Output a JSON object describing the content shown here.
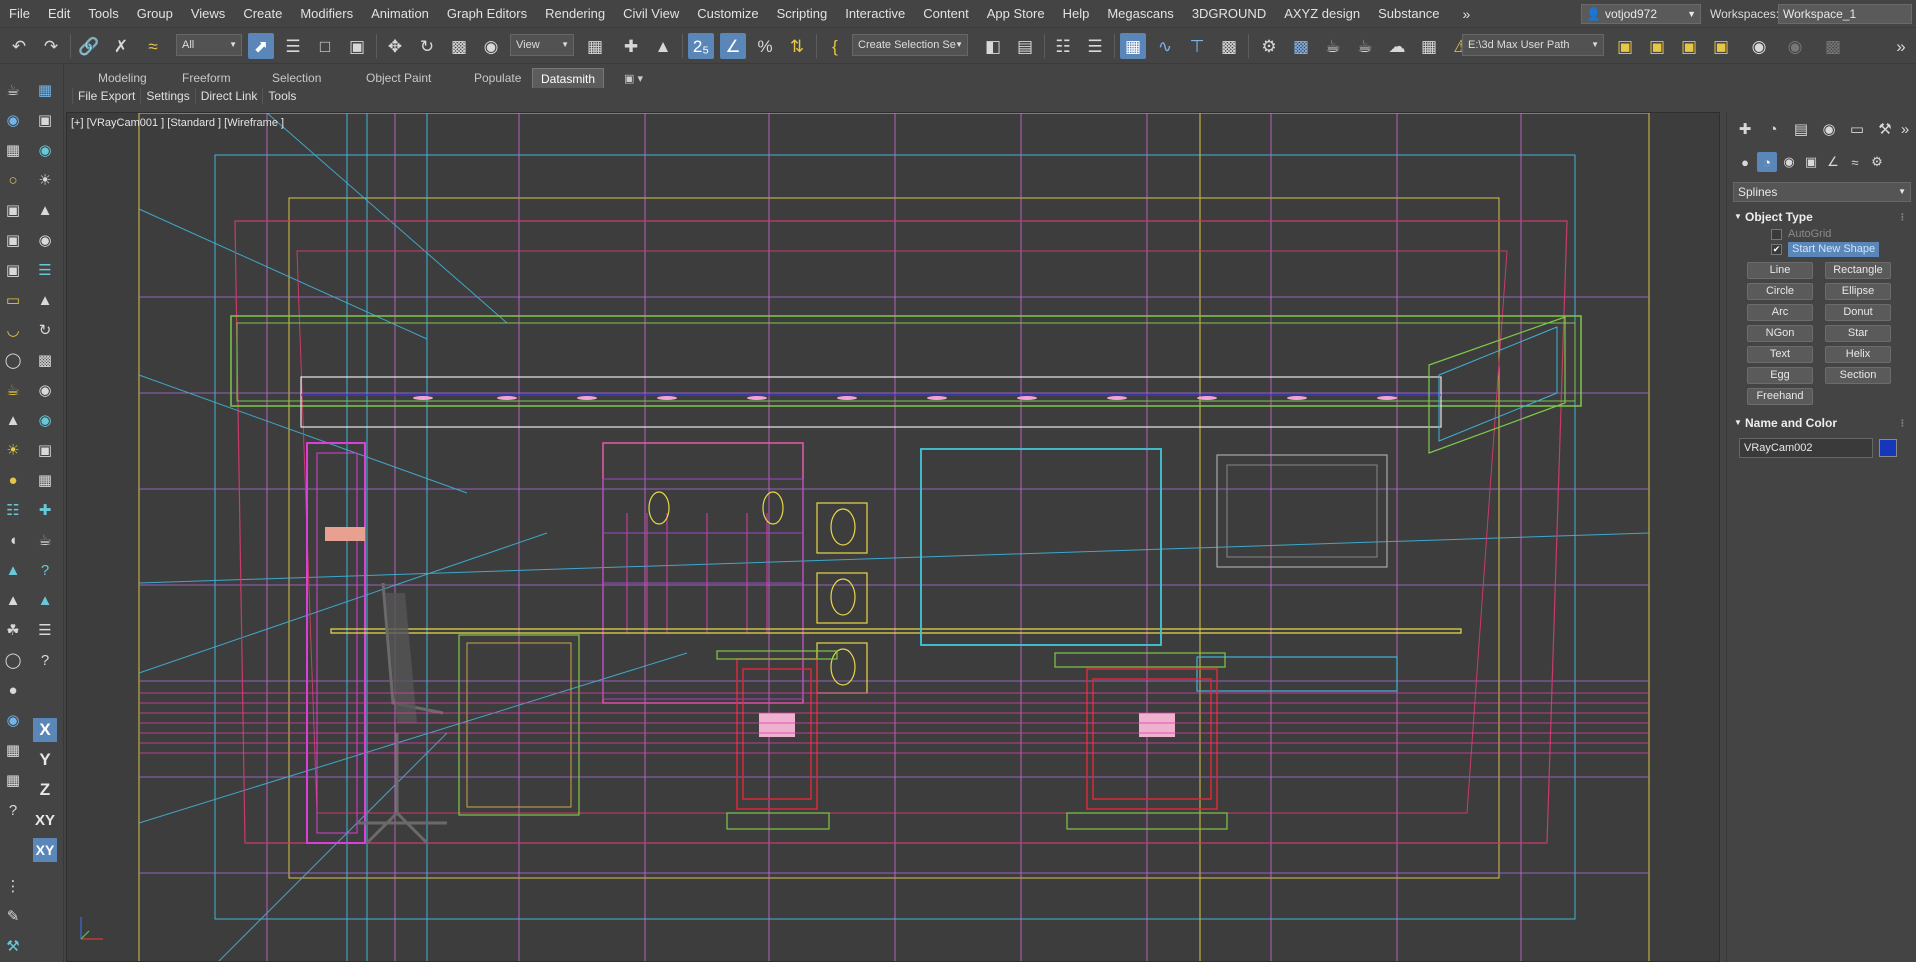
{
  "menubar": {
    "items": [
      "File",
      "Edit",
      "Tools",
      "Group",
      "Views",
      "Create",
      "Modifiers",
      "Animation",
      "Graph Editors",
      "Rendering",
      "Civil View",
      "Customize",
      "Scripting",
      "Interactive",
      "Content",
      "App Store",
      "Help",
      "Megascans",
      "3DGROUND",
      "AXYZ design",
      "Substance"
    ],
    "more": "»",
    "user": "votjod972",
    "workspaces_label": "Workspaces:",
    "workspace_value": "Workspace_1"
  },
  "toolbar": {
    "filter_dropdown": "All",
    "ref_coord_dropdown": "View",
    "selection_set_dropdown": "Create Selection Se",
    "user_path_dropdown": "E:\\3d Max User Path"
  },
  "ribbon": {
    "tabs": [
      "Modeling",
      "Freeform",
      "Selection",
      "Object Paint",
      "Populate",
      "Datasmith"
    ],
    "active_tab": "Datasmith",
    "sub_items": [
      "File Export",
      "Settings",
      "Direct Link",
      "Tools"
    ]
  },
  "viewport": {
    "label": "[+] [VRayCam001 ] [Standard ] [Wireframe ]"
  },
  "axis_constraints": [
    "X",
    "Y",
    "Z",
    "XY",
    "XY"
  ],
  "command_panel": {
    "category": "Splines",
    "object_type_title": "Object Type",
    "autogrid_label": "AutoGrid",
    "start_new_shape_label": "Start New Shape",
    "start_new_shape_checked": true,
    "buttons": [
      "Line",
      "Rectangle",
      "Circle",
      "Ellipse",
      "Arc",
      "Donut",
      "NGon",
      "Star",
      "Text",
      "Helix",
      "Egg",
      "Section",
      "Freehand"
    ],
    "name_color_title": "Name and Color",
    "object_name": "VRayCam002",
    "object_color": "#1637b8"
  }
}
